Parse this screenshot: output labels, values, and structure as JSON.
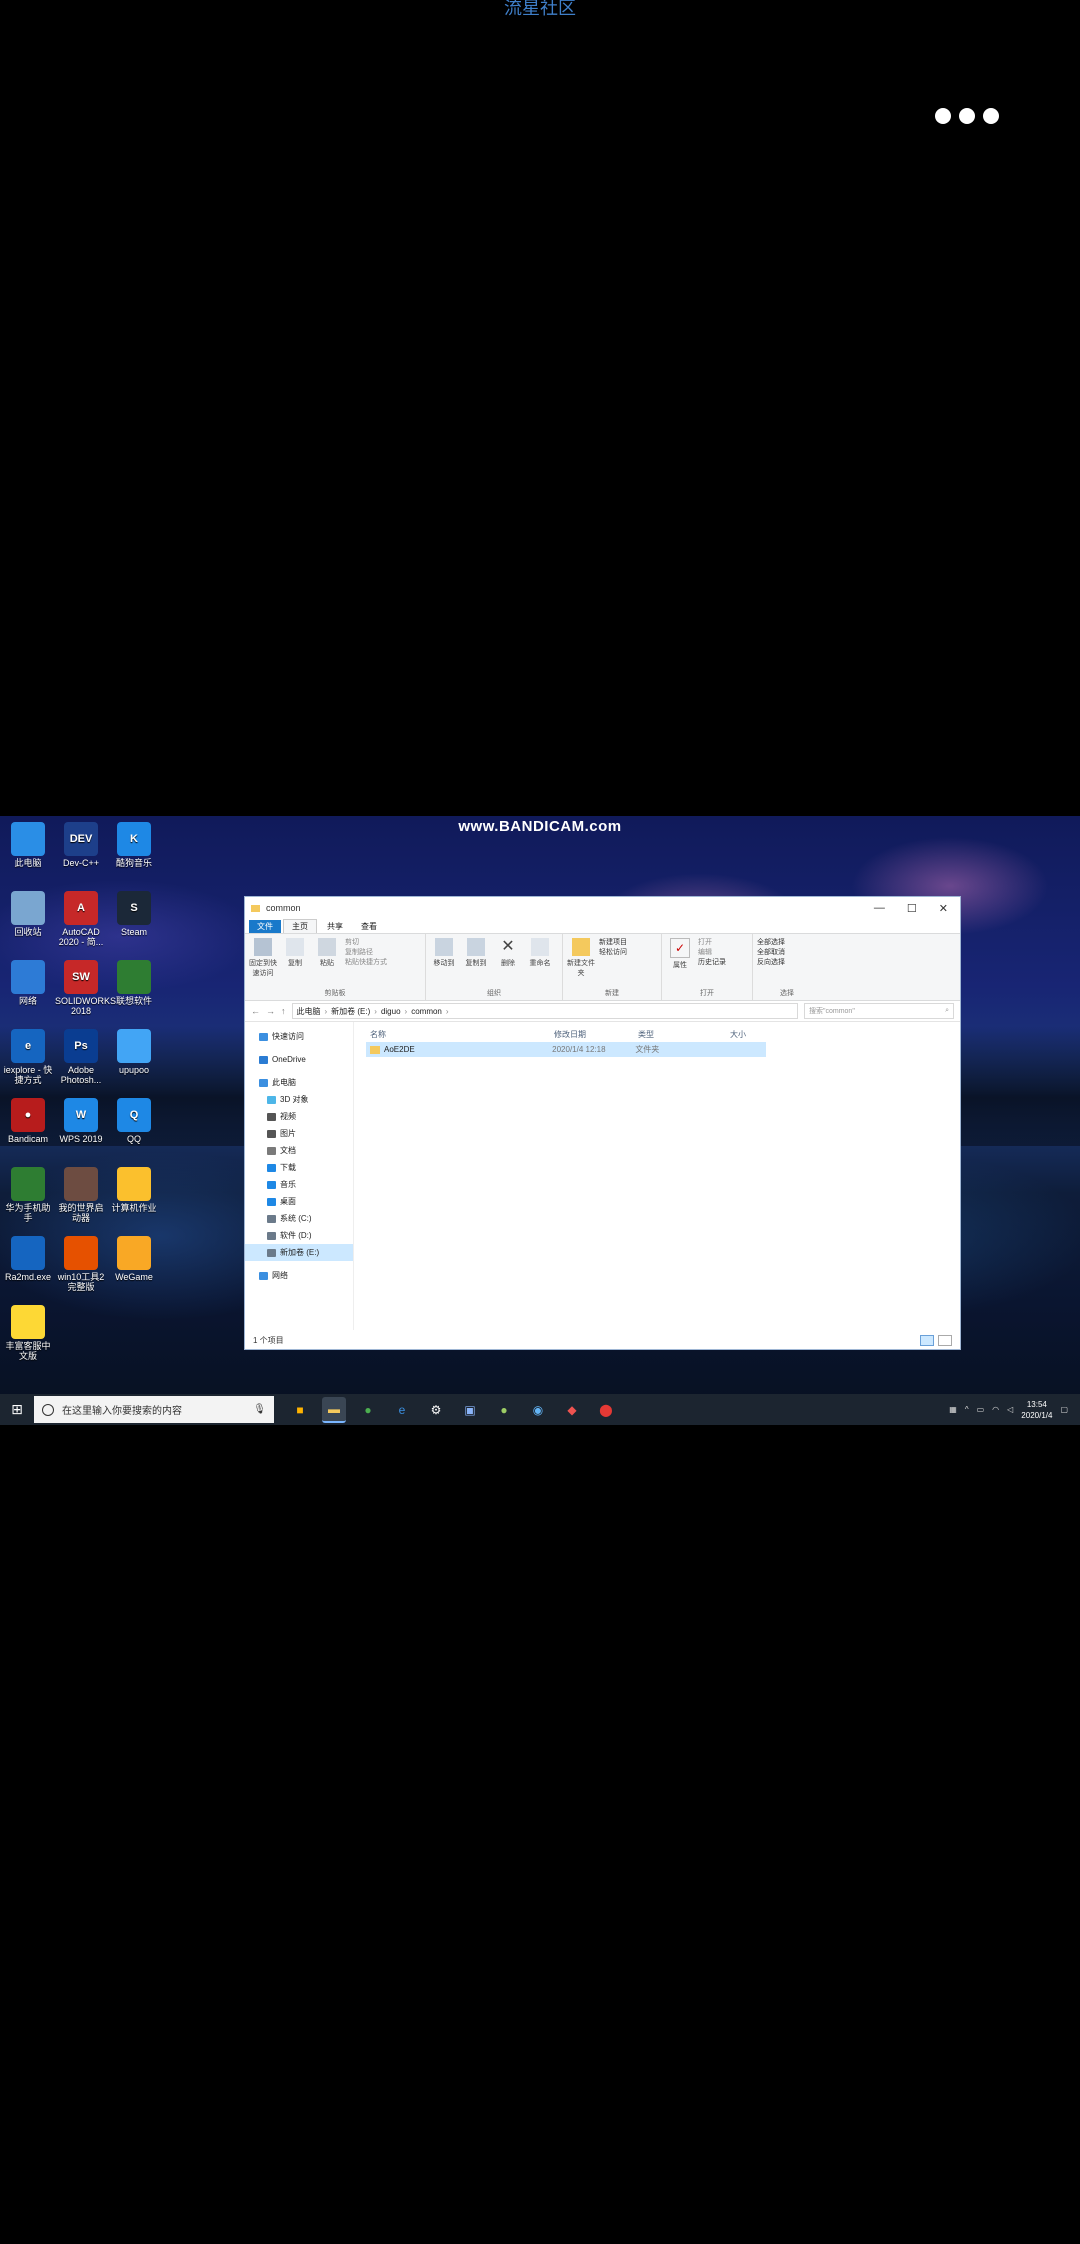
{
  "top_title": "流星社区",
  "more_menu": "more-dots",
  "video": {
    "watermark": "www.BANDICAM.com",
    "desktop_icons": [
      {
        "label": "此电脑",
        "color": "#2a8ee6"
      },
      {
        "label": "Dev-C++",
        "color": "#1d3f8a",
        "glyph": "DEV"
      },
      {
        "label": "酷狗音乐",
        "color": "#1e88e5",
        "glyph": "K"
      },
      {
        "label": "回收站",
        "color": "#7aa6d0"
      },
      {
        "label": "AutoCAD 2020 - 简...",
        "color": "#c62828",
        "glyph": "A"
      },
      {
        "label": "Steam",
        "color": "#1b2838",
        "glyph": "S"
      },
      {
        "label": "网络",
        "color": "#2d7bd6"
      },
      {
        "label": "SOLIDWORKS 2018",
        "color": "#c62828",
        "glyph": "SW"
      },
      {
        "label": "联想软件",
        "color": "#2e7d32"
      },
      {
        "label": "iexplore - 快捷方式",
        "color": "#1565c0",
        "glyph": "e"
      },
      {
        "label": "Adobe Photosh...",
        "color": "#0a3d91",
        "glyph": "Ps"
      },
      {
        "label": "upupoo",
        "color": "#42a5f5"
      },
      {
        "label": "Bandicam",
        "color": "#b71c1c",
        "glyph": "●"
      },
      {
        "label": "WPS 2019",
        "color": "#1e88e5",
        "glyph": "W"
      },
      {
        "label": "QQ",
        "color": "#1e88e5",
        "glyph": "Q"
      },
      {
        "label": "华为手机助手",
        "color": "#2e7d32"
      },
      {
        "label": "我的世界启动器",
        "color": "#6d4c41"
      },
      {
        "label": "计算机作业",
        "color": "#fbc02d"
      },
      {
        "label": "Ra2md.exe",
        "color": "#1565c0"
      },
      {
        "label": "win10工具2 完整版",
        "color": "#e65100"
      },
      {
        "label": "WeGame",
        "color": "#f9a825"
      },
      {
        "label": "丰富客服中文版",
        "color": "#fdd835"
      }
    ],
    "explorer": {
      "title": "common",
      "window_controls": {
        "minimize": "—",
        "maximize": "☐",
        "close": "✕"
      },
      "tabs": [
        "文件",
        "主页",
        "共享",
        "查看"
      ],
      "ribbon_groups": [
        {
          "caption": "剪贴板",
          "buttons": [
            "固定到快速访问",
            "复制",
            "粘贴"
          ],
          "small": [
            "剪切",
            "复制路径",
            "粘贴快捷方式"
          ]
        },
        {
          "caption": "组织",
          "buttons": [
            "移动到",
            "复制到",
            "删除",
            "重命名"
          ]
        },
        {
          "caption": "新建",
          "buttons": [
            "新建文件夹"
          ],
          "small": [
            "新建项目",
            "轻松访问"
          ]
        },
        {
          "caption": "打开",
          "buttons": [
            "属性"
          ],
          "small": [
            "打开",
            "编辑",
            "历史记录"
          ]
        },
        {
          "caption": "选择",
          "small": [
            "全部选择",
            "全部取消",
            "反向选择"
          ]
        }
      ],
      "path": [
        "此电脑",
        "新加卷 (E:)",
        "diguo",
        "common"
      ],
      "search_placeholder": "搜索\"common\"",
      "nav": [
        {
          "label": "快速访问",
          "color": "#3b8fe0",
          "sub": false
        },
        {
          "label": "OneDrive",
          "color": "#2b7cd3",
          "sub": false
        },
        {
          "label": "此电脑",
          "color": "#3b8fe0",
          "sub": false
        },
        {
          "label": "3D 对象",
          "color": "#4db6e8",
          "sub": true
        },
        {
          "label": "视频",
          "color": "#555",
          "sub": true
        },
        {
          "label": "图片",
          "color": "#555",
          "sub": true
        },
        {
          "label": "文档",
          "color": "#7a7a7a",
          "sub": true
        },
        {
          "label": "下载",
          "color": "#1e88e5",
          "sub": true
        },
        {
          "label": "音乐",
          "color": "#1e88e5",
          "sub": true
        },
        {
          "label": "桌面",
          "color": "#1e88e5",
          "sub": true
        },
        {
          "label": "系统 (C:)",
          "color": "#6b7a8a",
          "sub": true
        },
        {
          "label": "软件 (D:)",
          "color": "#6b7a8a",
          "sub": true
        },
        {
          "label": "新加卷 (E:)",
          "color": "#6b7a8a",
          "sub": true,
          "selected": true
        },
        {
          "label": "网络",
          "color": "#3b8fe0",
          "sub": false
        }
      ],
      "columns": [
        "名称",
        "修改日期",
        "类型",
        "大小"
      ],
      "rows": [
        {
          "name": "AoE2DE",
          "date": "2020/1/4 12:18",
          "type": "文件夹",
          "size": ""
        }
      ],
      "status": "1 个项目"
    },
    "taskbar": {
      "search_text": "在这里输入你要搜索的内容",
      "time": "13:54",
      "date": "2020/1/4"
    }
  }
}
